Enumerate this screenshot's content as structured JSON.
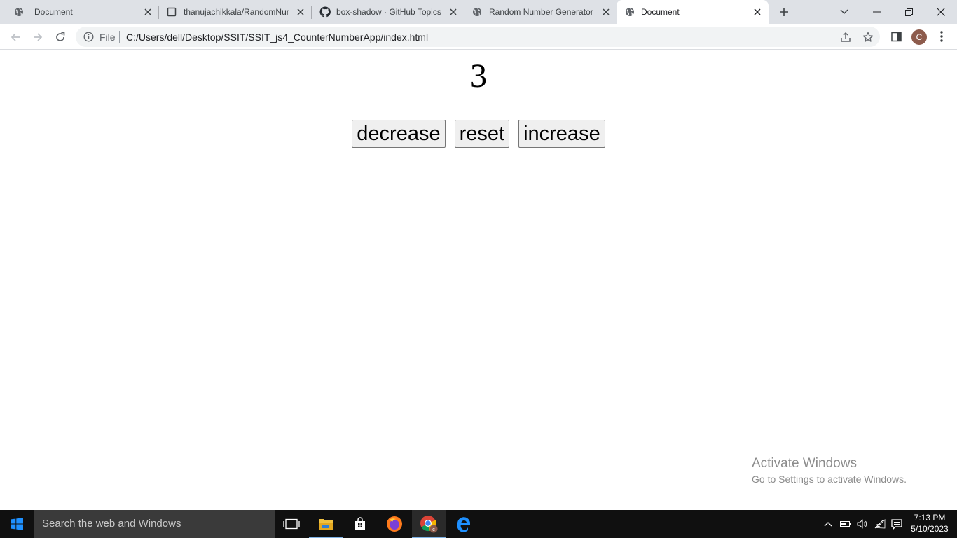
{
  "browser": {
    "tabs": [
      {
        "title": "Document",
        "icon": "globe-icon",
        "active": false
      },
      {
        "title": "thanujachikkala/RandomNum",
        "icon": "page-icon",
        "active": false
      },
      {
        "title": "box-shadow · GitHub Topics",
        "icon": "github-icon",
        "active": false
      },
      {
        "title": "Random Number Generator",
        "icon": "globe-icon",
        "active": false
      },
      {
        "title": "Document",
        "icon": "globe-icon",
        "active": true
      }
    ],
    "omnibox": {
      "scheme_label": "File",
      "url": "C:/Users/dell/Desktop/SSIT/SSIT_js4_CounterNumberApp/index.html"
    },
    "profile_initial": "C"
  },
  "page": {
    "counter_value": "3",
    "buttons": {
      "decrease": "decrease",
      "reset": "reset",
      "increase": "increase"
    }
  },
  "watermark": {
    "line1": "Activate Windows",
    "line2": "Go to Settings to activate Windows."
  },
  "taskbar": {
    "search_placeholder": "Search the web and Windows",
    "clock_time": "7:13 PM",
    "clock_date": "5/10/2023",
    "chrome_badge": "c"
  },
  "colors": {
    "tabstrip_bg": "#dee1e6",
    "omnibox_bg": "#f1f3f4",
    "taskbar_bg": "#101010",
    "avatar_bg": "#8d5b4c"
  }
}
